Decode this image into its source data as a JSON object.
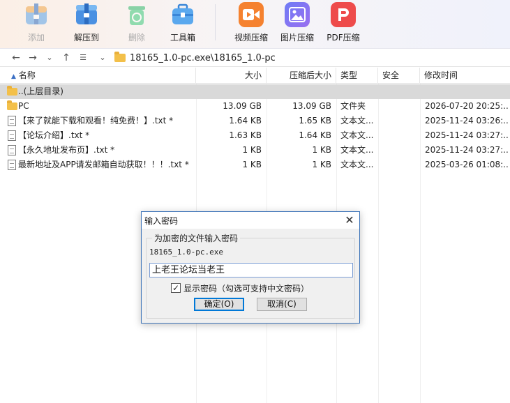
{
  "toolbar": {
    "buttons": [
      {
        "label": "添加",
        "icon": "add-archive-icon",
        "enabled": false
      },
      {
        "label": "解压到",
        "icon": "extract-to-icon",
        "enabled": true
      },
      {
        "label": "删除",
        "icon": "delete-recycle-icon",
        "enabled": false
      },
      {
        "label": "工具箱",
        "icon": "toolbox-icon",
        "enabled": true
      },
      {
        "label": "视频压缩",
        "icon": "video-compress-icon",
        "enabled": true
      },
      {
        "label": "图片压缩",
        "icon": "image-compress-icon",
        "enabled": true
      },
      {
        "label": "PDF压缩",
        "icon": "pdf-compress-icon",
        "enabled": true
      }
    ]
  },
  "address": {
    "path": "18165_1.0-pc.exe\\18165_1.0-pc"
  },
  "columns": [
    "名称",
    "大小",
    "压缩后大小",
    "类型",
    "安全",
    "修改时间"
  ],
  "files": [
    {
      "name": "..(上层目录)",
      "size": "",
      "packed": "",
      "type": "",
      "safety": "",
      "modified": "",
      "kind": "folder",
      "selected": true
    },
    {
      "name": "PC",
      "size": "13.09 GB",
      "packed": "13.09 GB",
      "type": "文件夹",
      "safety": "",
      "modified": "2026-07-20 20:25:...",
      "kind": "folder",
      "selected": false
    },
    {
      "name": "【来了就能下载和观看！纯免费！】.txt *",
      "size": "1.64 KB",
      "packed": "1.65 KB",
      "type": "文本文...",
      "safety": "",
      "modified": "2025-11-24 03:26:...",
      "kind": "doc",
      "selected": false
    },
    {
      "name": "【论坛介绍】.txt *",
      "size": "1.63 KB",
      "packed": "1.64 KB",
      "type": "文本文...",
      "safety": "",
      "modified": "2025-11-24 03:27:...",
      "kind": "doc",
      "selected": false
    },
    {
      "name": "【永久地址发布页】.txt *",
      "size": "1 KB",
      "packed": "1 KB",
      "type": "文本文...",
      "safety": "",
      "modified": "2025-11-24 03:27:...",
      "kind": "doc",
      "selected": false
    },
    {
      "name": "最新地址及APP请发邮箱自动获取！！！.txt *",
      "size": "1 KB",
      "packed": "1 KB",
      "type": "文本文...",
      "safety": "",
      "modified": "2025-03-26 01:08:...",
      "kind": "doc",
      "selected": false
    }
  ],
  "dialog": {
    "title": "输入密码",
    "group_title": "为加密的文件输入密码",
    "filename": "18165_1.0-pc.exe",
    "password_value": "上老王论坛当老王",
    "show_password_label": "显示密码（勾选可支持中文密码）",
    "show_password_checked": true,
    "ok_label": "确定(O)",
    "cancel_label": "取消(C)"
  },
  "colors": {
    "accent": "#3c73b8",
    "folder": "#f3c04a",
    "selected_row": "#d9d9d9"
  }
}
